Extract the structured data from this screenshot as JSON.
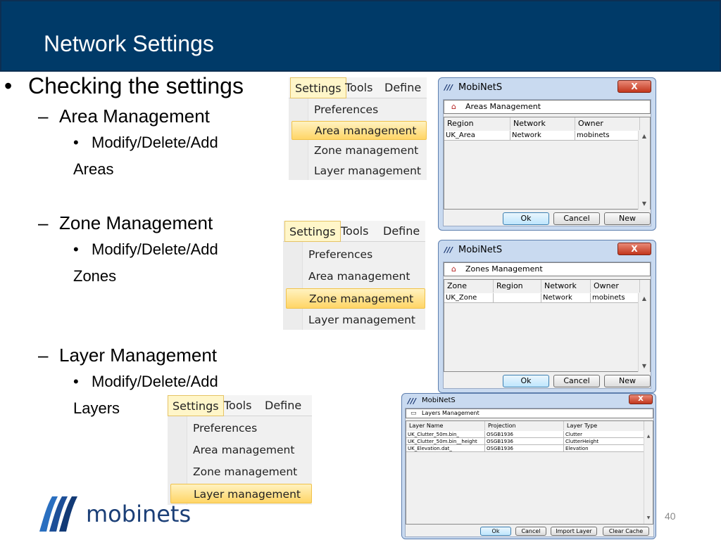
{
  "slide": {
    "title": "Network Settings",
    "page_number": "40",
    "logo_text": "mobinets"
  },
  "bullets": {
    "main": "Checking the settings",
    "area": {
      "heading": "Area Management",
      "sub_line1": "Modify/Delete/Add",
      "sub_line2": "Areas"
    },
    "zone": {
      "heading": "Zone Management",
      "sub_line1": "Modify/Delete/Add",
      "sub_line2": "Zones"
    },
    "layer": {
      "heading": "Layer Management",
      "sub_line1": "Modify/Delete/Add",
      "sub_line2": "Layers"
    },
    "dash": "–",
    "dot": "•"
  },
  "menus": [
    {
      "bar": [
        "Settings",
        "Tools",
        "Define"
      ],
      "items": [
        "Preferences",
        "Area management",
        "Zone management",
        "Layer management"
      ],
      "highlighted": "Area management"
    },
    {
      "bar": [
        "Settings",
        "Tools",
        "Define"
      ],
      "items": [
        "Preferences",
        "Area management",
        "Zone management",
        "Layer management"
      ],
      "highlighted": "Zone management"
    },
    {
      "bar": [
        "Settings",
        "Tools",
        "Define"
      ],
      "items": [
        "Preferences",
        "Area management",
        "Zone management",
        "Layer management"
      ],
      "highlighted": "Layer management"
    }
  ],
  "dialogs": {
    "app_title": "MobiNetS",
    "close_glyph": "X",
    "areas": {
      "group_title": "Areas Management",
      "columns": [
        "Region",
        "Network",
        "Owner"
      ],
      "rows": [
        [
          "UK_Area",
          "Network",
          "mobinets"
        ]
      ],
      "buttons": [
        "Ok",
        "Cancel",
        "New"
      ]
    },
    "zones": {
      "group_title": "Zones Management",
      "columns": [
        "Zone",
        "Region",
        "Network",
        "Owner"
      ],
      "rows": [
        [
          "UK_Zone",
          "",
          "Network",
          "mobinets"
        ]
      ],
      "buttons": [
        "Ok",
        "Cancel",
        "New"
      ]
    },
    "layers": {
      "group_title": "Layers Management",
      "columns": [
        "Layer Name",
        "Projection",
        "Layer Type"
      ],
      "rows": [
        [
          "UK_Clutter_50m.bin_",
          "OSGB1936",
          "Clutter"
        ],
        [
          "UK_Clutter_50m.bin__height",
          "OSGB1936",
          "ClutterHeight"
        ],
        [
          "UK_Elevation.dat_",
          "OSGB1936",
          "Elevation"
        ]
      ],
      "buttons": [
        "Ok",
        "Cancel",
        "Import Layer",
        "Clear Cache"
      ]
    }
  },
  "icons": {
    "app": "mobinets-logo-icon",
    "group": "house-icon",
    "scroll_up": "arrow-up-icon",
    "scroll_down": "arrow-down-icon"
  },
  "colors": {
    "header_bg": "#003a68",
    "menu_highlight": "#ffd566",
    "dialog_frame": "#c9daf0",
    "close_button": "#c2361c",
    "logo_blue": "#1b3f77"
  }
}
